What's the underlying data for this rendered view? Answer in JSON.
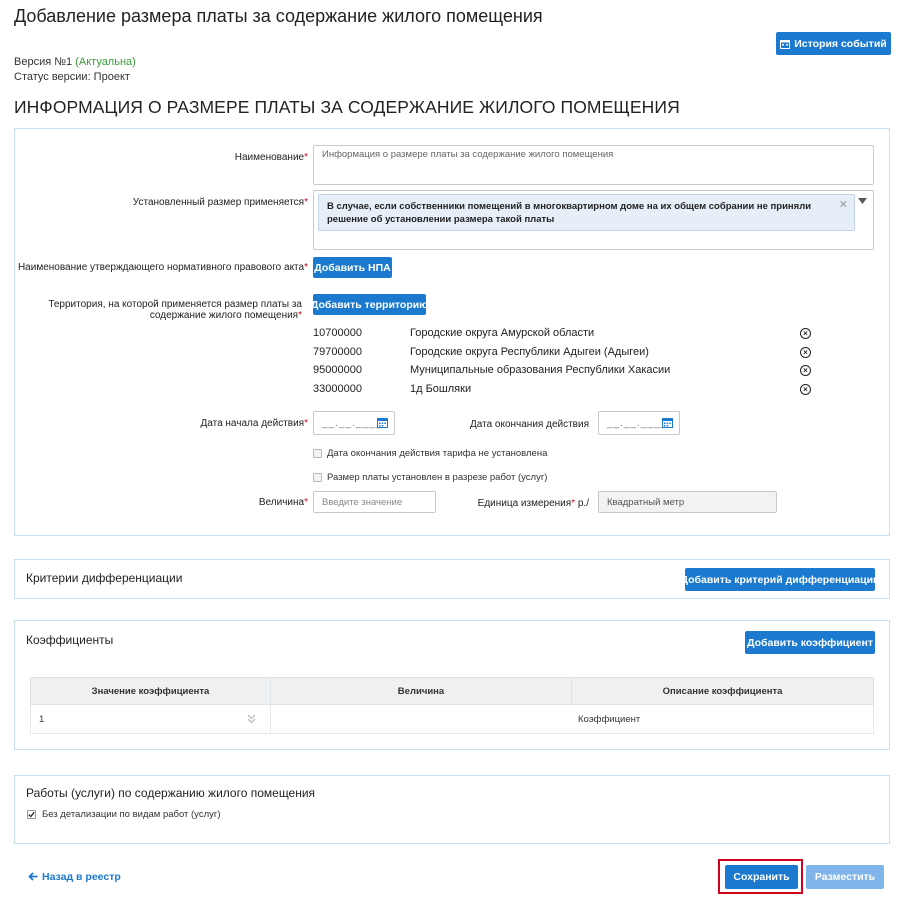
{
  "header": {
    "title": "Добавление размера платы за содержание жилого помещения",
    "history_button": "История событий",
    "version_label": "Версия №1",
    "version_status": "(Актуальна)",
    "status_line": "Статус версии: Проект"
  },
  "info_section": {
    "title": "ИНФОРМАЦИЯ О РАЗМЕРЕ ПЛАТЫ ЗА СОДЕРЖАНИЕ ЖИЛОГО ПОМЕЩЕНИЯ",
    "name_label": "Наименование",
    "name_value": "Информация о размере платы за содержание жилого помещения",
    "applies_label": "Установленный размер применяется",
    "applies_tag": "В случае, если собственники помещений в многоквартирном доме на их общем собрании не приняли решение об установлении размера такой платы",
    "npa_label": "Наименование утверждающего нормативного правового акта",
    "npa_button": "Добавить НПА",
    "territory_label": "Территория, на которой применяется размер платы за содержание жилого помещения",
    "territory_button": "Добавить территорию",
    "territories": [
      {
        "code": "10700000",
        "name": "Городские округа Амурской области"
      },
      {
        "code": "79700000",
        "name": "Городские округа Республики Адыгеи (Адыгеи)"
      },
      {
        "code": "95000000",
        "name": "Муниципальные образования Республики Хакасии"
      },
      {
        "code": "33000000",
        "name": "1д Бошляки"
      }
    ],
    "date_start_label": "Дата начала действия",
    "date_end_label": "Дата окончания действия",
    "date_mask": "__.__.____",
    "no_end_date_label": "Дата окончания действия тарифа не установлена",
    "by_works_label": "Размер платы установлен в разрезе работ (услуг)",
    "value_label": "Величина",
    "value_placeholder": "Введите значение",
    "unit_label": "Единица измерения",
    "unit_prefix": "р./",
    "unit_value": "Квадратный метр"
  },
  "criteria": {
    "title": "Критерии дифференциации",
    "add_button": "Добавить критерий дифференциации"
  },
  "coefficients": {
    "title": "Коэффициенты",
    "add_button": "Добавить коэффициент",
    "columns": [
      "Значение коэффициента",
      "Величина",
      "Описание коэффициента"
    ],
    "rows": [
      {
        "value": "1",
        "amount": "",
        "description": "Коэффициент"
      }
    ]
  },
  "works": {
    "title": "Работы (услуги) по содержанию жилого помещения",
    "no_detail_label": "Без детализации по видам работ (услуг)",
    "no_detail_checked": true
  },
  "footer": {
    "back_link": "Назад в реестр",
    "save_button": "Сохранить",
    "publish_button": "Разместить"
  },
  "colors": {
    "primary": "#1b7ad0",
    "required": "#d0021b",
    "active_status": "#3b9a3b",
    "highlight": "#d0021b"
  }
}
